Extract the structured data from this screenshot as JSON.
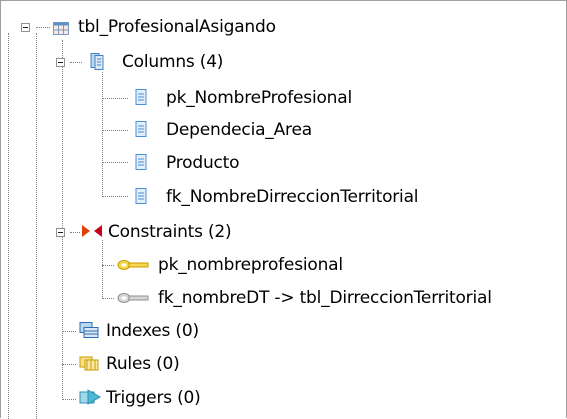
{
  "tree": {
    "table": {
      "label": "tbl_ProfesionalAsigando",
      "icon": "table-icon"
    },
    "columns": {
      "label": "Columns (4)",
      "icon": "columns-folder-icon",
      "items": [
        {
          "label": "pk_NombreProfesional",
          "icon": "column-icon"
        },
        {
          "label": "Dependecia_Area",
          "icon": "column-icon"
        },
        {
          "label": "Producto",
          "icon": "column-icon"
        },
        {
          "label": "fk_NombreDirreccionTerritorial",
          "icon": "column-icon"
        }
      ]
    },
    "constraints": {
      "label": "Constraints (2)",
      "icon": "constraints-icon",
      "items": [
        {
          "label": "pk_nombreprofesional",
          "icon": "primary-key-icon"
        },
        {
          "label": "fk_nombreDT -> tbl_DirreccionTerritorial",
          "icon": "foreign-key-icon"
        }
      ]
    },
    "indexes": {
      "label": "Indexes (0)",
      "icon": "indexes-icon"
    },
    "rules": {
      "label": "Rules (0)",
      "icon": "rules-icon"
    },
    "triggers": {
      "label": "Triggers (0)",
      "icon": "triggers-icon"
    }
  },
  "colors": {
    "connector": "#808080",
    "border": "#a0a0a0",
    "column_icon": "#4a90d9",
    "key_gold": "#e8b800",
    "key_gray": "#8f8f8f",
    "constraint_orange": "#e04000",
    "constraint_red": "#c80018"
  }
}
